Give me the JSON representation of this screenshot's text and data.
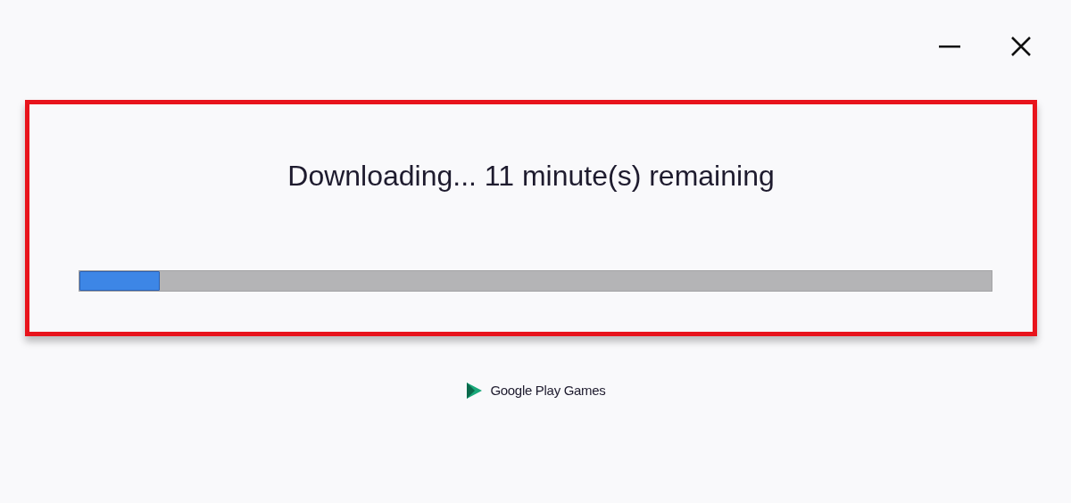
{
  "status": {
    "text": "Downloading... 11 minute(s) remaining"
  },
  "progress": {
    "level": 0.088
  },
  "footer": {
    "brand": "Google Play Games"
  }
}
